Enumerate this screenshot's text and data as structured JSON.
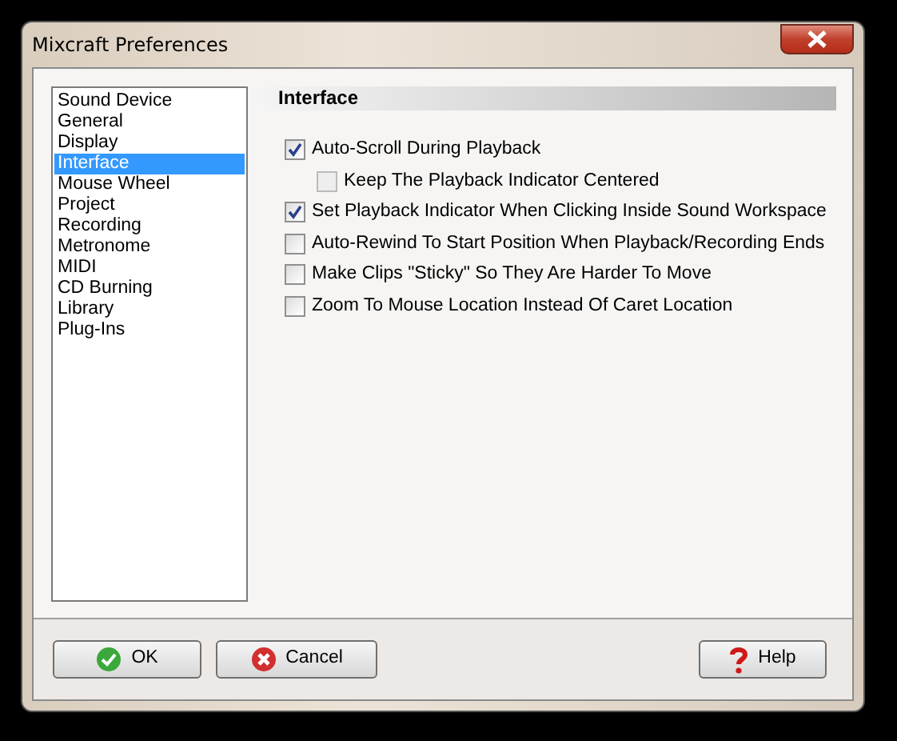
{
  "window": {
    "title": "Mixcraft Preferences"
  },
  "sidebar": {
    "items": [
      {
        "label": "Sound Device",
        "selected": false
      },
      {
        "label": "General",
        "selected": false
      },
      {
        "label": "Display",
        "selected": false
      },
      {
        "label": "Interface",
        "selected": true
      },
      {
        "label": "Mouse Wheel",
        "selected": false
      },
      {
        "label": "Project",
        "selected": false
      },
      {
        "label": "Recording",
        "selected": false
      },
      {
        "label": "Metronome",
        "selected": false
      },
      {
        "label": "MIDI",
        "selected": false
      },
      {
        "label": "CD Burning",
        "selected": false
      },
      {
        "label": "Library",
        "selected": false
      },
      {
        "label": "Plug-Ins",
        "selected": false
      }
    ]
  },
  "panel": {
    "title": "Interface",
    "options": [
      {
        "label": "Auto-Scroll During Playback",
        "checked": true,
        "disabled": false,
        "children": [
          {
            "label": "Keep The Playback Indicator Centered",
            "checked": false,
            "disabled": true
          }
        ]
      },
      {
        "label": "Set Playback Indicator When Clicking Inside Sound Workspace",
        "checked": true,
        "disabled": false
      },
      {
        "label": "Auto-Rewind To Start Position When Playback/Recording Ends",
        "checked": false,
        "disabled": false
      },
      {
        "label": "Make Clips \"Sticky\" So They Are Harder To Move",
        "checked": false,
        "disabled": false
      },
      {
        "label": "Zoom To Mouse Location Instead Of Caret Location",
        "checked": false,
        "disabled": false
      }
    ]
  },
  "buttons": [
    {
      "label": "OK",
      "kind": "ok"
    },
    {
      "label": "Cancel",
      "kind": "cancel"
    },
    {
      "label": "Help",
      "kind": "help"
    }
  ]
}
